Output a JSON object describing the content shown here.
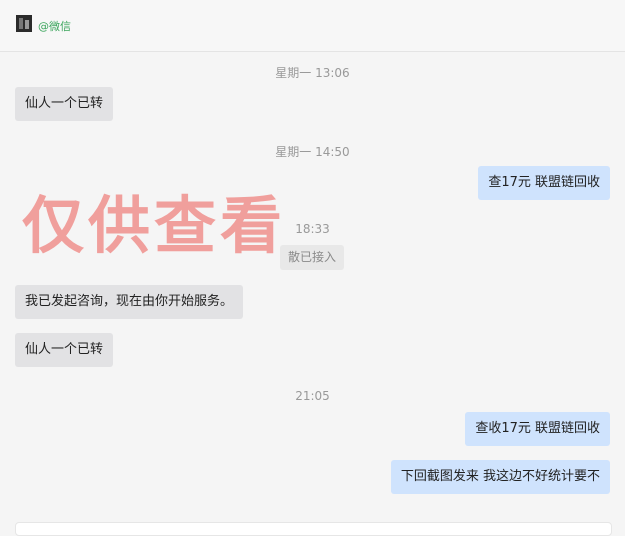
{
  "header": {
    "contact_name": "@微信"
  },
  "messages": [
    {
      "time": "星期一 13:06"
    },
    {
      "text": "仙人一个已转"
    },
    {
      "time": "星期一 14:50"
    },
    {
      "text": "查17元  联盟链回收"
    },
    {
      "time": "18:33"
    },
    {
      "system": "散已接入"
    },
    {
      "text": "我已发起咨询，现在由你开始服务。"
    },
    {
      "text": "仙人一个已转"
    },
    {
      "time": "21:05"
    },
    {
      "text": "查收17元   联盟链回收"
    },
    {
      "text": "下回截图发来   我这边不好统计要不"
    }
  ],
  "watermark": "仅供查看"
}
